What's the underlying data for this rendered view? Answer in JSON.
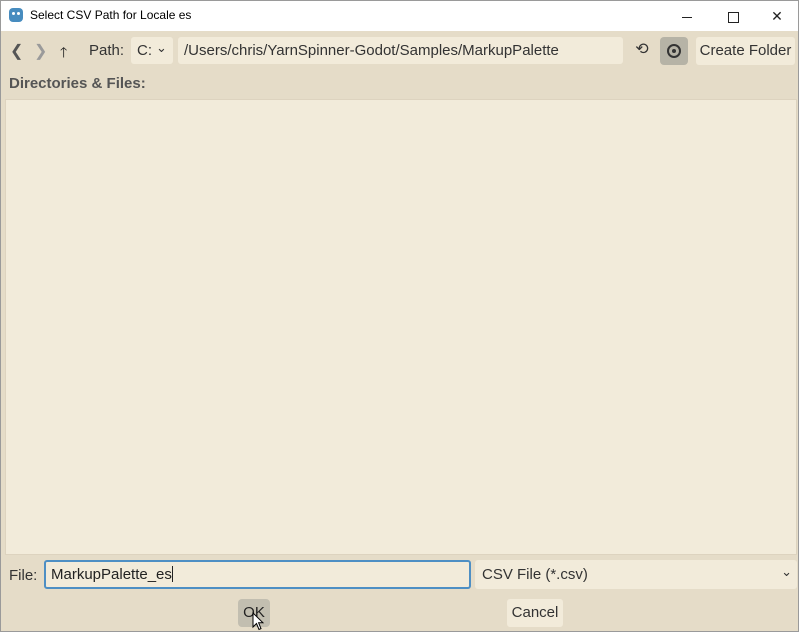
{
  "window": {
    "title": "Select CSV Path for Locale es",
    "controls": {
      "minimize_icon": "minimize-icon",
      "maximize_icon": "maximize-icon",
      "close_glyph": "✕"
    }
  },
  "toolbar": {
    "back_glyph": "❮",
    "forward_glyph": "❯",
    "up_glyph": "🡑",
    "path_label": "Path:",
    "drive": "C:",
    "drive_chevron": "⌄",
    "path": "/Users/chris/YarnSpinner-Godot/Samples/MarkupPalette",
    "refresh_glyph": "⟲",
    "create_folder_label": "Create Folder"
  },
  "browser": {
    "label": "Directories & Files:",
    "items": []
  },
  "footer": {
    "file_label": "File:",
    "file_name": "MarkupPalette_es",
    "filter": "CSV File (*.csv)",
    "filter_chevron": "⌄",
    "ok_label": "OK",
    "cancel_label": "Cancel"
  },
  "colors": {
    "background": "#e5dcc8",
    "field": "#f2ebda",
    "focus_accent": "#4e8fc4",
    "godot_blue": "#478cbf"
  }
}
